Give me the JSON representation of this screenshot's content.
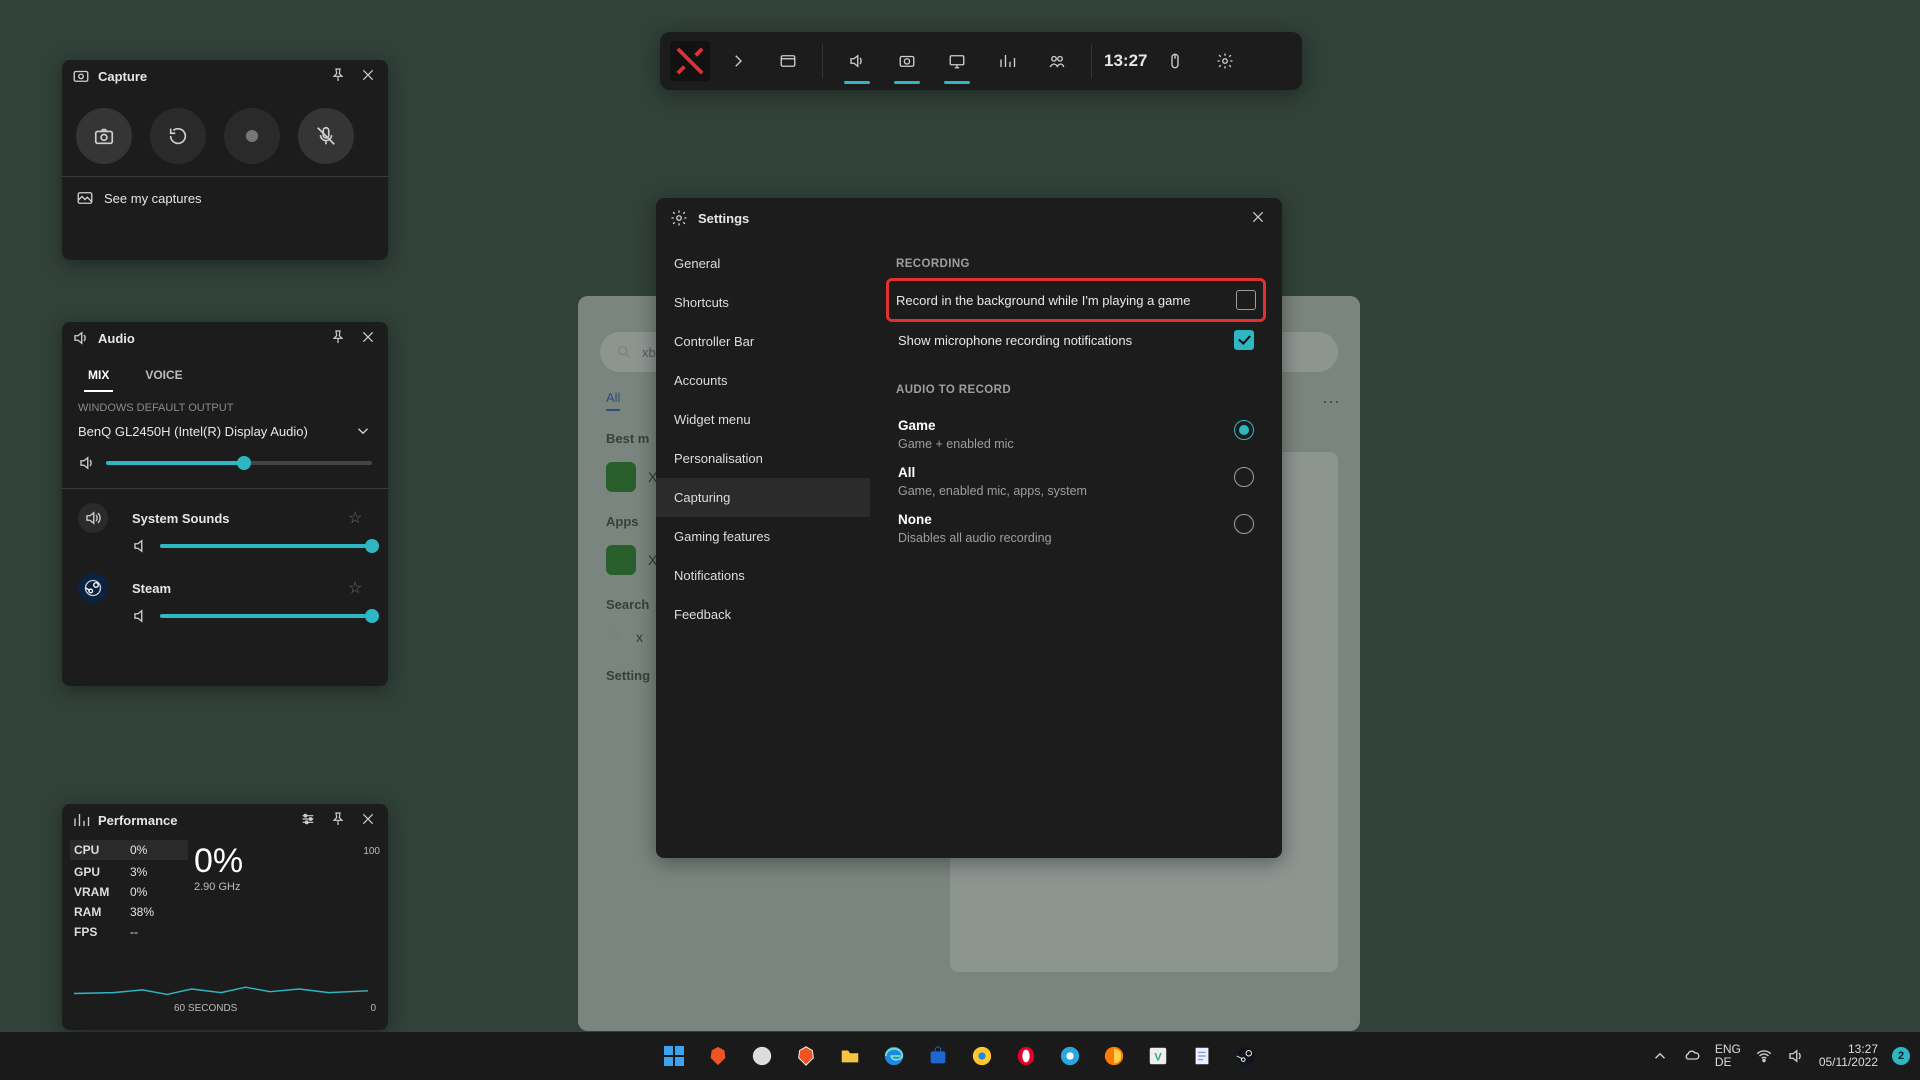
{
  "gamebar": {
    "time": "13:27",
    "buttons": [
      "widgets",
      "audio",
      "capture",
      "display",
      "performance",
      "xbox-social"
    ],
    "active_underlines": [
      "audio",
      "capture",
      "display"
    ]
  },
  "capture": {
    "title": "Capture",
    "see_captures": "See my captures"
  },
  "audio": {
    "title": "Audio",
    "tabs": {
      "mix": "MIX",
      "voice": "VOICE"
    },
    "default_output_label": "WINDOWS DEFAULT OUTPUT",
    "device": "BenQ GL2450H (Intel(R) Display Audio)",
    "master_pct": 52,
    "apps": [
      {
        "name": "System Sounds",
        "pct": 100,
        "kind": "speaker"
      },
      {
        "name": "Steam",
        "pct": 100,
        "kind": "steam"
      }
    ]
  },
  "performance": {
    "title": "Performance",
    "stats": [
      {
        "k": "CPU",
        "v": "0%"
      },
      {
        "k": "GPU",
        "v": "3%"
      },
      {
        "k": "VRAM",
        "v": "0%"
      },
      {
        "k": "RAM",
        "v": "38%"
      },
      {
        "k": "FPS",
        "v": "--"
      }
    ],
    "big_pct": "0%",
    "big_sub": "2.90 GHz",
    "axis_top": "100",
    "axis_bottom": "0",
    "axis_label": "60 SECONDS"
  },
  "startmock": {
    "search_prefix": "xb",
    "tabs": {
      "all": "All"
    },
    "best_label": "Best m",
    "apps_label": "Apps",
    "search_label": "Search",
    "settings_label": "Setting",
    "x_items": [
      "X",
      "X",
      "x"
    ],
    "more": "⋯"
  },
  "settings": {
    "title": "Settings",
    "nav": [
      "General",
      "Shortcuts",
      "Controller Bar",
      "Accounts",
      "Widget menu",
      "Personalisation",
      "Capturing",
      "Gaming features",
      "Notifications",
      "Feedback"
    ],
    "nav_selected": "Capturing",
    "recording_header": "RECORDING",
    "record_bg": "Record in the background while I'm playing a game",
    "record_bg_checked": false,
    "mic_notif": "Show microphone recording notifications",
    "mic_notif_checked": true,
    "audio_header": "AUDIO TO RECORD",
    "audio_options": [
      {
        "title": "Game",
        "sub": "Game + enabled mic",
        "selected": true
      },
      {
        "title": "All",
        "sub": "Game, enabled mic, apps, system",
        "selected": false
      },
      {
        "title": "None",
        "sub": "Disables all audio recording",
        "selected": false
      }
    ]
  },
  "taskbar": {
    "lang1": "ENG",
    "lang2": "DE",
    "time": "13:27",
    "date": "05/11/2022",
    "notif_count": "2",
    "apps": [
      "start",
      "brave",
      "github",
      "brave-shield",
      "files",
      "edge",
      "store",
      "chrome-canary",
      "opera",
      "chrome-dev",
      "firefox",
      "vnc",
      "notes",
      "steam"
    ]
  }
}
